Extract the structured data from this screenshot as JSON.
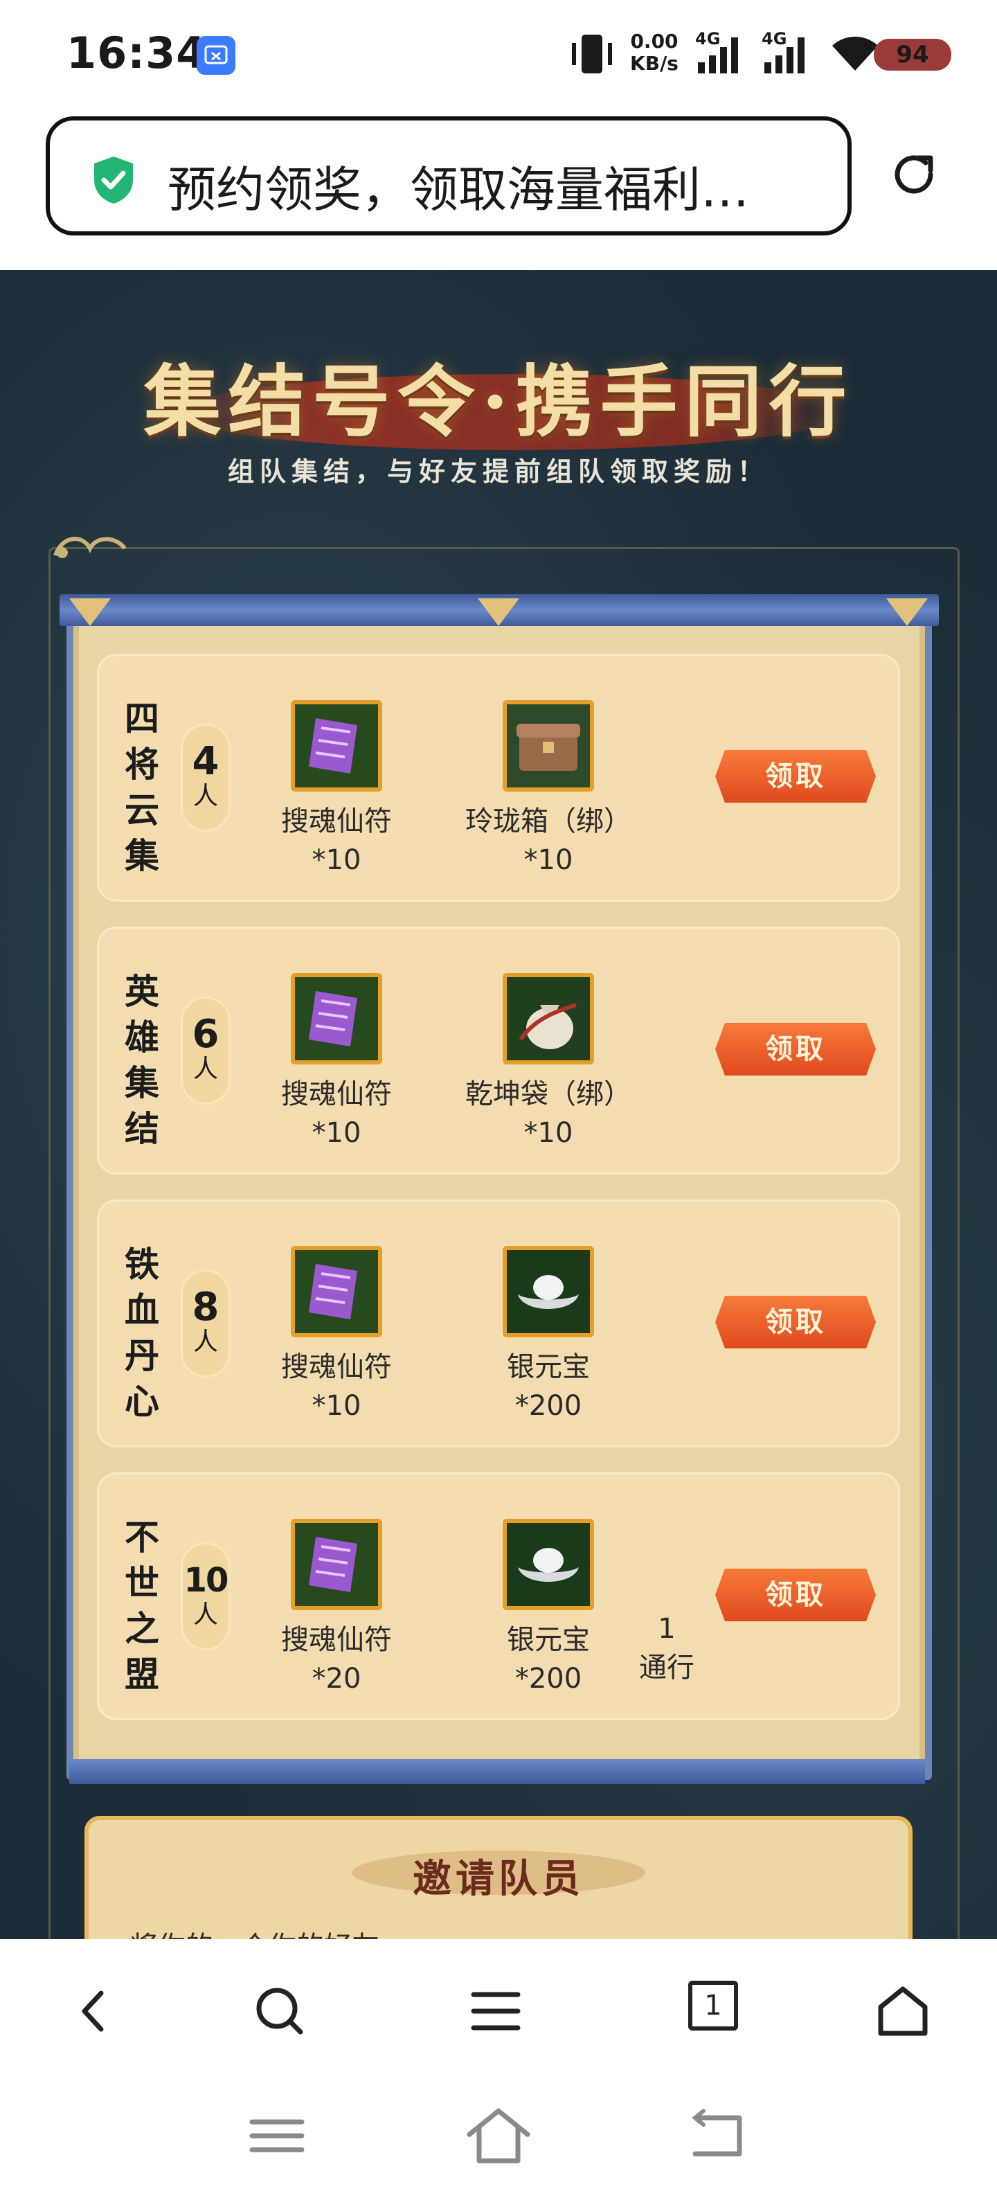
{
  "status_bar": {
    "time": "16:34",
    "net_speed_value": "0.00",
    "net_speed_unit": "KB/s",
    "signal1_label": "4G",
    "signal2_label": "4G",
    "battery": "94"
  },
  "url_bar": {
    "title": "预约领奖，领取海量福利…"
  },
  "hero": {
    "title": "集结号令·携手同行",
    "subtitle": "组队集结，与好友提前组队领取奖励！"
  },
  "rewards": [
    {
      "name": "四将云集",
      "count": "4",
      "unit": "人",
      "items": [
        {
          "name": "搜魂仙符",
          "qty": "*10",
          "icon": "purple-talisman"
        },
        {
          "name": "玲珑箱（绑）",
          "qty": "*10",
          "icon": "treasure-chest"
        }
      ],
      "button": "领取"
    },
    {
      "name": "英雄集结",
      "count": "6",
      "unit": "人",
      "items": [
        {
          "name": "搜魂仙符",
          "qty": "*10",
          "icon": "purple-talisman"
        },
        {
          "name": "乾坤袋（绑）",
          "qty": "*10",
          "icon": "cloth-bag"
        }
      ],
      "button": "领取"
    },
    {
      "name": "铁血丹心",
      "count": "8",
      "unit": "人",
      "items": [
        {
          "name": "搜魂仙符",
          "qty": "*10",
          "icon": "purple-talisman"
        },
        {
          "name": "银元宝",
          "qty": "*200",
          "icon": "silver-ingot"
        }
      ],
      "button": "领取"
    },
    {
      "name": "不世之盟",
      "count": "10",
      "unit": "人",
      "items": [
        {
          "name": "搜魂仙符",
          "qty": "*20",
          "icon": "purple-talisman"
        },
        {
          "name": "银元宝",
          "qty": "*200",
          "icon": "silver-ingot"
        }
      ],
      "extra": {
        "line1": "1",
        "line2": "通行"
      },
      "button": "领取"
    }
  ],
  "invite": {
    "title": "邀请队员",
    "text": "将你的一个你的好友"
  },
  "browser_nav": {
    "tab_count": "1"
  },
  "colors": {
    "page_bg": "#1c2d38",
    "scroll_bg": "#e9d5a4",
    "claim_button": "#e85a28",
    "title_gold": "#f3dfa6"
  }
}
